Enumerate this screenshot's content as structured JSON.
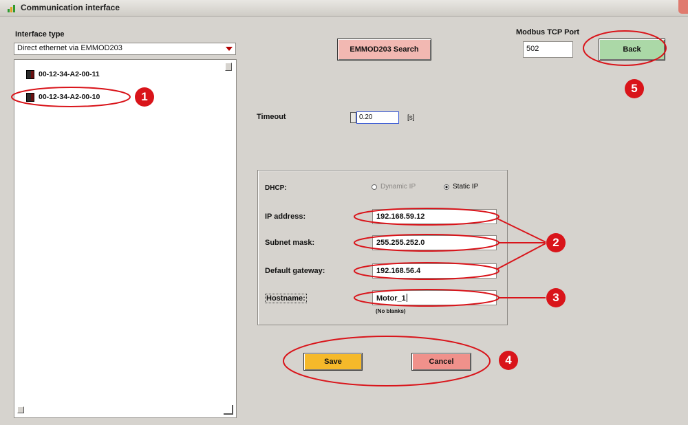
{
  "window": {
    "title": "Communication interface"
  },
  "interface_type": {
    "label": "Interface type",
    "selected": "Direct ethernet via EMMOD203"
  },
  "device_list": {
    "items": [
      {
        "label": "00-12-34-A2-00-11"
      },
      {
        "label": "00-12-34-A2-00-10"
      }
    ]
  },
  "search_button": {
    "label": "EMMOD203 Search"
  },
  "modbus": {
    "label": "Modbus TCP Port",
    "value": "502"
  },
  "back_button": {
    "label": "Back"
  },
  "timeout": {
    "label": "Timeout",
    "value": "0.20",
    "unit": "[s]"
  },
  "network": {
    "dhcp_label": "DHCP:",
    "dynamic_ip_label": "Dynamic IP",
    "static_ip_label": "Static IP",
    "ip_label": "IP address:",
    "ip_value": "192.168.59.12",
    "subnet_label": "Subnet mask:",
    "subnet_value": "255.255.252.0",
    "gateway_label": "Default gateway:",
    "gateway_value": "192.168.56.4",
    "hostname_label": "Hostname:",
    "hostname_value": "Motor_1",
    "hostname_hint": "(No blanks)"
  },
  "save_button": {
    "label": "Save"
  },
  "cancel_button": {
    "label": "Cancel"
  },
  "callouts": {
    "c1": "1",
    "c2": "2",
    "c3": "3",
    "c4": "4",
    "c5": "5"
  },
  "colors": {
    "window_bg": "#d6d3ce",
    "annotation_red": "#d9141a",
    "search_button": "#f2b8b2",
    "back_button": "#abd8a7",
    "save_button": "#f5b92a",
    "cancel_button": "#f0918b"
  }
}
